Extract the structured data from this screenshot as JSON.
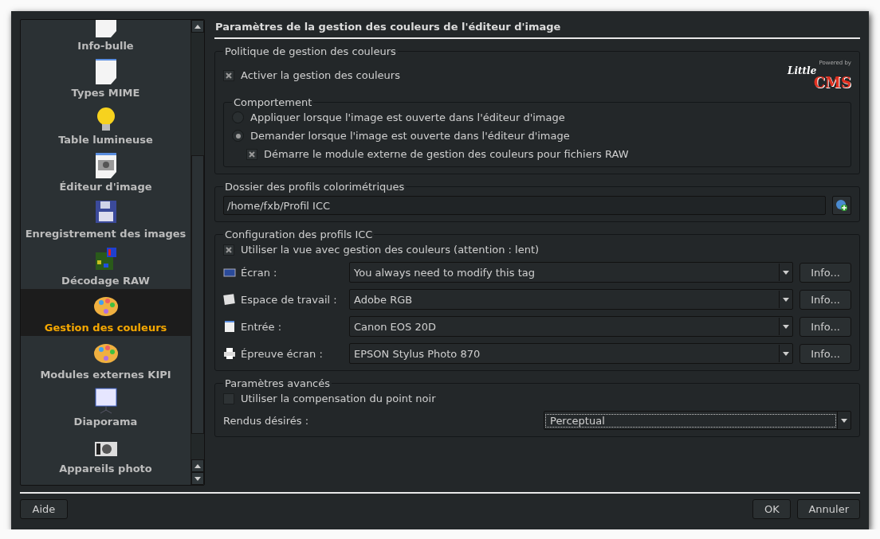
{
  "sidebar": {
    "items": [
      {
        "label": "Info-bulle",
        "kind": "page",
        "selected": false
      },
      {
        "label": "Types MIME",
        "kind": "page",
        "selected": false
      },
      {
        "label": "Table lumineuse",
        "kind": "bulb",
        "selected": false
      },
      {
        "label": "Éditeur d'image",
        "kind": "photo",
        "selected": false
      },
      {
        "label": "Enregistrement des images",
        "kind": "floppy",
        "selected": false
      },
      {
        "label": "Décodage RAW",
        "kind": "raw",
        "selected": false
      },
      {
        "label": "Gestion des couleurs",
        "kind": "palette",
        "selected": true
      },
      {
        "label": "Modules externes KIPI",
        "kind": "palette",
        "selected": false
      },
      {
        "label": "Diaporama",
        "kind": "screen",
        "selected": false
      },
      {
        "label": "Appareils photo",
        "kind": "camera",
        "selected": false
      }
    ]
  },
  "header": "Paramètres de la gestion des couleurs de l'éditeur d'image",
  "policy": {
    "title": "Politique de gestion des couleurs",
    "enable": {
      "label": "Activer la gestion des couleurs",
      "checked": true
    },
    "logo": {
      "powered": "Powered by",
      "top": "Little",
      "bottom": "CMS"
    },
    "behavior": {
      "title": "Comportement",
      "options": [
        {
          "label": "Appliquer lorsque l'image est ouverte dans l'éditeur d'image",
          "selected": false
        },
        {
          "label": "Demander lorsque l'image est ouverte dans l'éditeur d'image",
          "selected": true
        }
      ],
      "raw": {
        "label": "Démarre le module externe de gestion des couleurs pour fichiers RAW",
        "checked": true
      }
    }
  },
  "folder": {
    "title": "Dossier des profils colorimétriques",
    "value": "/home/fxb/Profil ICC"
  },
  "icc": {
    "title": "Configuration des profils ICC",
    "softproof": {
      "label": "Utiliser la vue avec gestion des couleurs (attention : lent)",
      "checked": true
    },
    "rows": [
      {
        "kind": "monitor",
        "label": "Écran :",
        "value": "You always need to modify this tag",
        "button": "Info..."
      },
      {
        "kind": "workspace",
        "label": "Espace de travail :",
        "value": "Adobe RGB",
        "button": "Info..."
      },
      {
        "kind": "input",
        "label": "Entrée :",
        "value": "Canon EOS 20D",
        "button": "Info..."
      },
      {
        "kind": "printer",
        "label": "Épreuve écran :",
        "value": "EPSON Stylus Photo 870",
        "button": "Info..."
      }
    ]
  },
  "advanced": {
    "title": "Paramètres avancés",
    "blackpoint": {
      "label": "Utiliser la compensation du point noir",
      "checked": false
    },
    "intent": {
      "label": "Rendus désirés :",
      "value": "Perceptual"
    }
  },
  "buttons": {
    "help": "Aide",
    "ok": "OK",
    "cancel": "Annuler"
  }
}
